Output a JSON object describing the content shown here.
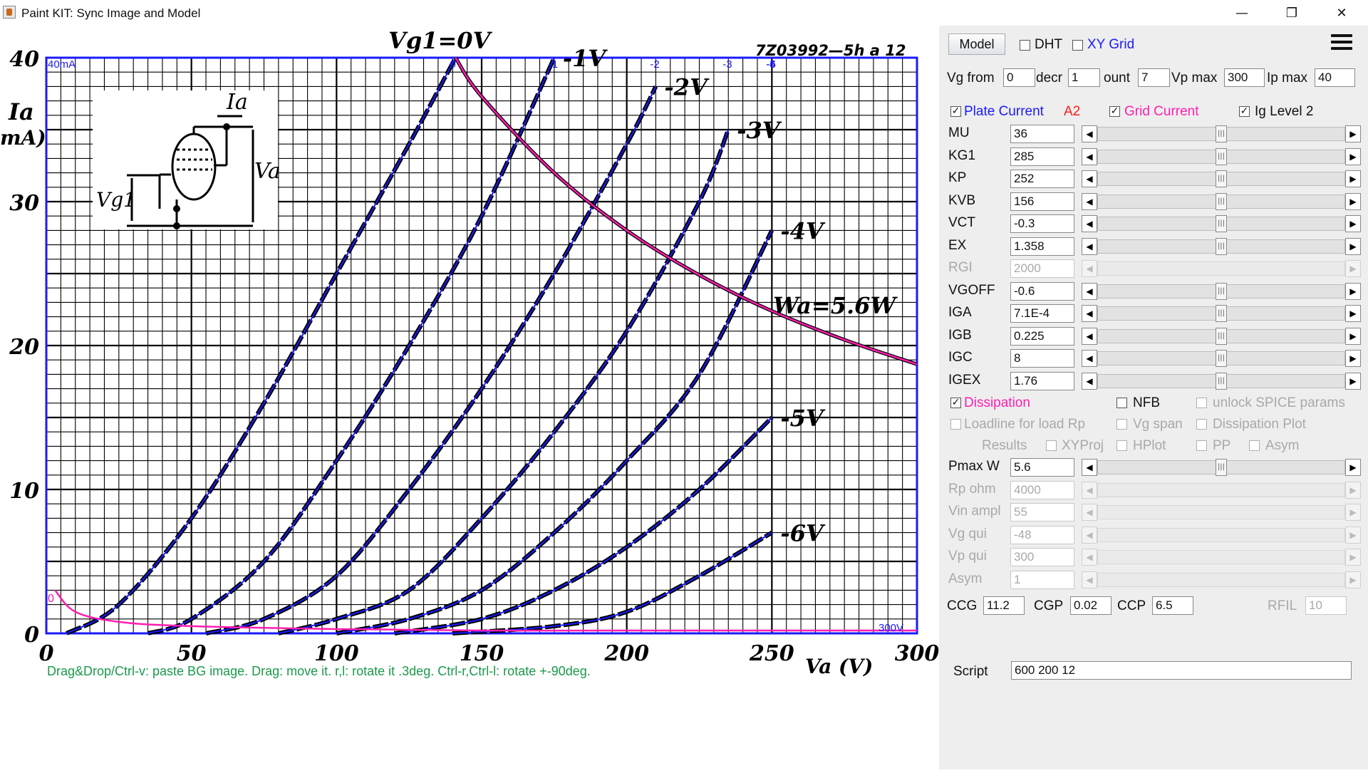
{
  "window": {
    "title": "Paint KIT: Sync Image and Model",
    "min_glyph": "—",
    "max_glyph": "❐",
    "close_glyph": "✕"
  },
  "graph": {
    "hint": "Drag&Drop/Ctrl-v: paste BG image. Drag: move it. r,l: rotate it .3deg. Ctrl-r,Ctrl-l: rotate +-90deg.",
    "code": "7Z03992—5h a 12",
    "ia_label": "Ia",
    "ma_label": "mA)",
    "va_axis_label": "Va (V)",
    "model_ymax_label": "40mA",
    "model_xmax_label": "300V",
    "wa_label": "Wa=5.6W",
    "vg1_zero_label": "Vg1=0V",
    "schematic_ia": "Ia",
    "schematic_va": "Va",
    "schematic_vg1": "Vg1",
    "grid_current_label": "0"
  },
  "chart_data": {
    "type": "line",
    "title": "",
    "xlabel": "Va (V)",
    "ylabel": "Ia (mA)",
    "xlim": [
      0,
      300
    ],
    "ylim": [
      0,
      40
    ],
    "x_ticks": [
      "0",
      "50",
      "100",
      "150",
      "200",
      "250",
      "300"
    ],
    "y_ticks": [
      "0",
      "10",
      "20",
      "30",
      "40"
    ],
    "grid": true,
    "series": [
      {
        "name": "0V",
        "model_label": "0",
        "x": [
          7,
          25,
          50,
          75,
          100,
          125,
          141
        ],
        "y": [
          0,
          2,
          8,
          16,
          25,
          34,
          40
        ]
      },
      {
        "name": "-1V",
        "model_label": "-1",
        "x": [
          35,
          50,
          75,
          100,
          125,
          150,
          175
        ],
        "y": [
          0,
          1,
          5,
          12,
          20,
          29,
          40
        ]
      },
      {
        "name": "-2V",
        "model_label": "-2",
        "x": [
          55,
          75,
          100,
          125,
          150,
          175,
          200,
          210
        ],
        "y": [
          0,
          1,
          4,
          10,
          17,
          25,
          34,
          38
        ]
      },
      {
        "name": "-3V",
        "model_label": "-3",
        "x": [
          80,
          100,
          125,
          150,
          175,
          200,
          225,
          235
        ],
        "y": [
          0,
          1,
          3,
          8,
          14,
          21,
          30,
          35
        ]
      },
      {
        "name": "-4V",
        "model_label": "-4",
        "x": [
          100,
          125,
          150,
          175,
          200,
          225,
          250
        ],
        "y": [
          0,
          1,
          3,
          7,
          12,
          18,
          28
        ]
      },
      {
        "name": "-5V",
        "model_label": "-5",
        "x": [
          120,
          150,
          175,
          200,
          225,
          250
        ],
        "y": [
          0,
          1,
          3,
          6,
          10,
          15
        ]
      },
      {
        "name": "-6V",
        "model_label": "-6",
        "x": [
          140,
          175,
          200,
          225,
          250
        ],
        "y": [
          0,
          0.5,
          1.5,
          4,
          7
        ]
      },
      {
        "name": "Wa=5.6W",
        "x": [
          141,
          150,
          175,
          200,
          225,
          250,
          275,
          300
        ],
        "y": [
          40,
          37.3,
          32,
          28,
          24.9,
          22.4,
          20.4,
          18.7
        ]
      },
      {
        "name": "Grid Current",
        "x": [
          3,
          10,
          25,
          50,
          100,
          150,
          200,
          300
        ],
        "y": [
          3,
          1.5,
          0.8,
          0.5,
          0.3,
          0.2,
          0.2,
          0.2
        ]
      }
    ]
  },
  "panel": {
    "model_btn": "Model",
    "dht": "DHT",
    "xygrid": "XY Grid",
    "vgfrom_label": "Vg from",
    "vgfrom_value": "0",
    "decr_label": "decr",
    "decr_value": "1",
    "count_label": "ount",
    "count_value": "7",
    "vpmax_label": "Vp max",
    "vpmax_value": "300",
    "ipmax_label": "Ip max",
    "ipmax_value": "40",
    "plate_current": "Plate Current",
    "a2": "A2",
    "grid_current": "Grid Current",
    "ig_level": "Ig Level 2",
    "params": [
      {
        "name": "MU",
        "value": "36",
        "enabled": true,
        "level": 0.5
      },
      {
        "name": "KG1",
        "value": "285",
        "enabled": true,
        "level": 0.5
      },
      {
        "name": "KP",
        "value": "252",
        "enabled": true,
        "level": 0.5
      },
      {
        "name": "KVB",
        "value": "156",
        "enabled": true,
        "level": 0.5
      },
      {
        "name": "VCT",
        "value": "-0.3",
        "enabled": true,
        "level": 0.5
      },
      {
        "name": "EX",
        "value": "1.358",
        "enabled": true,
        "level": 0.5
      },
      {
        "name": "RGI",
        "value": "2000",
        "enabled": false,
        "level": 0
      },
      {
        "name": "VGOFF",
        "value": "-0.6",
        "enabled": true,
        "level": 0.5
      },
      {
        "name": "IGA",
        "value": "7.1E-4",
        "enabled": true,
        "level": 0.5
      },
      {
        "name": "IGB",
        "value": "0.225",
        "enabled": true,
        "level": 0.5
      },
      {
        "name": "IGC",
        "value": "8",
        "enabled": true,
        "level": 0.5
      },
      {
        "name": "IGEX",
        "value": "1.76",
        "enabled": true,
        "level": 0.5
      }
    ],
    "dissipation": "Dissipation",
    "nfb": "NFB",
    "unlock": "unlock SPICE params",
    "loadline": "Loadline for load Rp",
    "vgspan": "Vg span",
    "dissplot": "Dissipation Plot",
    "results": "Results",
    "xyproj": "XYProj",
    "hplot": "HPlot",
    "pp": "PP",
    "asym_cb": "Asym",
    "params2": [
      {
        "name": "Pmax W",
        "value": "5.6",
        "enabled": true,
        "level": 0.5
      },
      {
        "name": "Rp ohm",
        "value": "4000",
        "enabled": false,
        "level": 0
      },
      {
        "name": "Vin ampl",
        "value": "55",
        "enabled": false,
        "level": 0
      },
      {
        "name": "Vg qui",
        "value": "-48",
        "enabled": false,
        "level": 0
      },
      {
        "name": "Vp qui",
        "value": "300",
        "enabled": false,
        "level": 0
      },
      {
        "name": "Asym",
        "value": "1",
        "enabled": false,
        "level": 0
      }
    ],
    "ccg_label": "CCG",
    "ccg_value": "11.2",
    "cgp_label": "CGP",
    "cgp_value": "0.02",
    "ccp_label": "CCP",
    "ccp_value": "6.5",
    "rfil_label": "RFIL",
    "rfil_value": "10",
    "script_label": "Script",
    "script_value": "600 200 12"
  },
  "colors": {
    "model_curve": "#1a1aff",
    "power_curve": "#ff1fb0",
    "a2": "#ff1a1a",
    "hint": "#1a9a4a"
  }
}
